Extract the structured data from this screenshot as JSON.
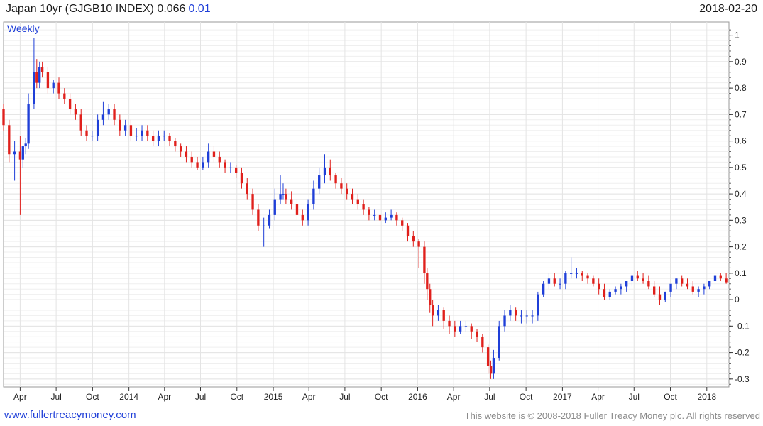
{
  "header": {
    "title": "Japan 10yr (GJGB10 INDEX) 0.066",
    "change": "0.01",
    "date": "2018-02-20"
  },
  "footer": {
    "website": "www.fullertreacymoney.com",
    "copyright": "This website is © 2008-2018 Fuller Treacy Money plc. All rights reserved"
  },
  "colors": {
    "up": "#1f3fd8",
    "down": "#e0201c",
    "grid": "#e4e4e4",
    "axis": "#333333"
  },
  "chart_data": {
    "type": "candlestick",
    "period_label": "Weekly",
    "ylim": [
      -0.33,
      1.05
    ],
    "y_ticks": [
      1,
      0.9,
      0.8,
      0.7,
      0.6,
      0.5,
      0.4,
      0.3,
      0.2,
      0.1,
      0,
      -0.1,
      -0.2,
      -0.3
    ],
    "y_tick_labels": [
      "1",
      "0.9",
      "0.8",
      "0.7",
      "0.6",
      "0.5",
      "0.4",
      "0.3",
      "0.2",
      "0.1",
      "0",
      "-0.1",
      "-0.2",
      "-0.3"
    ],
    "x_range": [
      "2013-02-18",
      "2018-02-26"
    ],
    "x_ticks": [
      {
        "date": "2013-04-01",
        "label": "Apr"
      },
      {
        "date": "2013-07-01",
        "label": "Jul"
      },
      {
        "date": "2013-10-01",
        "label": "Oct"
      },
      {
        "date": "2014-01-01",
        "label": "2014"
      },
      {
        "date": "2014-04-01",
        "label": "Apr"
      },
      {
        "date": "2014-07-01",
        "label": "Jul"
      },
      {
        "date": "2014-10-01",
        "label": "Oct"
      },
      {
        "date": "2015-01-01",
        "label": "2015"
      },
      {
        "date": "2015-04-01",
        "label": "Apr"
      },
      {
        "date": "2015-07-01",
        "label": "Jul"
      },
      {
        "date": "2015-10-01",
        "label": "Oct"
      },
      {
        "date": "2016-01-01",
        "label": "2016"
      },
      {
        "date": "2016-04-01",
        "label": "Apr"
      },
      {
        "date": "2016-07-01",
        "label": "Jul"
      },
      {
        "date": "2016-10-01",
        "label": "Oct"
      },
      {
        "date": "2017-01-01",
        "label": "2017"
      },
      {
        "date": "2017-04-01",
        "label": "Apr"
      },
      {
        "date": "2017-07-01",
        "label": "Jul"
      },
      {
        "date": "2017-10-01",
        "label": "Oct"
      },
      {
        "date": "2018-01-01",
        "label": "2018"
      }
    ],
    "series": [
      {
        "name": "GJGB10 INDEX",
        "x": [
          "2013-02-18",
          "2013-03-04",
          "2013-03-18",
          "2013-04-01",
          "2013-04-08",
          "2013-04-15",
          "2013-04-22",
          "2013-05-06",
          "2013-05-13",
          "2013-05-20",
          "2013-05-27",
          "2013-06-10",
          "2013-06-24",
          "2013-07-08",
          "2013-07-22",
          "2013-08-05",
          "2013-08-19",
          "2013-09-02",
          "2013-09-16",
          "2013-09-30",
          "2013-10-14",
          "2013-10-28",
          "2013-11-11",
          "2013-11-25",
          "2013-12-09",
          "2013-12-23",
          "2014-01-06",
          "2014-01-20",
          "2014-02-03",
          "2014-02-17",
          "2014-03-03",
          "2014-03-17",
          "2014-03-31",
          "2014-04-14",
          "2014-04-28",
          "2014-05-12",
          "2014-05-26",
          "2014-06-09",
          "2014-06-23",
          "2014-07-07",
          "2014-07-21",
          "2014-08-04",
          "2014-08-18",
          "2014-09-01",
          "2014-09-15",
          "2014-09-29",
          "2014-10-13",
          "2014-10-27",
          "2014-11-10",
          "2014-11-24",
          "2014-12-08",
          "2014-12-22",
          "2015-01-05",
          "2015-01-19",
          "2015-01-26",
          "2015-02-02",
          "2015-02-16",
          "2015-03-02",
          "2015-03-16",
          "2015-03-30",
          "2015-04-13",
          "2015-04-27",
          "2015-05-11",
          "2015-05-25",
          "2015-06-08",
          "2015-06-22",
          "2015-07-06",
          "2015-07-20",
          "2015-08-03",
          "2015-08-17",
          "2015-08-31",
          "2015-09-14",
          "2015-09-28",
          "2015-10-12",
          "2015-10-26",
          "2015-11-09",
          "2015-11-23",
          "2015-12-07",
          "2015-12-21",
          "2016-01-04",
          "2016-01-18",
          "2016-01-25",
          "2016-02-01",
          "2016-02-08",
          "2016-02-22",
          "2016-03-07",
          "2016-03-21",
          "2016-04-04",
          "2016-04-18",
          "2016-05-02",
          "2016-05-16",
          "2016-05-30",
          "2016-06-13",
          "2016-06-27",
          "2016-07-04",
          "2016-07-11",
          "2016-07-25",
          "2016-08-08",
          "2016-08-22",
          "2016-09-05",
          "2016-09-19",
          "2016-10-03",
          "2016-10-17",
          "2016-10-31",
          "2016-11-14",
          "2016-11-28",
          "2016-12-12",
          "2016-12-26",
          "2017-01-09",
          "2017-01-23",
          "2017-02-06",
          "2017-02-20",
          "2017-03-06",
          "2017-03-20",
          "2017-04-03",
          "2017-04-17",
          "2017-05-01",
          "2017-05-15",
          "2017-05-29",
          "2017-06-12",
          "2017-06-26",
          "2017-07-10",
          "2017-07-24",
          "2017-08-07",
          "2017-08-21",
          "2017-09-04",
          "2017-09-18",
          "2017-10-02",
          "2017-10-16",
          "2017-10-30",
          "2017-11-13",
          "2017-11-27",
          "2017-12-11",
          "2017-12-25",
          "2018-01-08",
          "2018-01-22",
          "2018-02-05",
          "2018-02-19"
        ],
        "open": [
          0.72,
          0.66,
          0.55,
          0.56,
          0.53,
          0.58,
          0.59,
          0.74,
          0.86,
          0.82,
          0.88,
          0.86,
          0.8,
          0.82,
          0.78,
          0.76,
          0.72,
          0.7,
          0.64,
          0.62,
          0.62,
          0.68,
          0.7,
          0.72,
          0.68,
          0.64,
          0.66,
          0.62,
          0.62,
          0.64,
          0.62,
          0.6,
          0.62,
          0.62,
          0.6,
          0.58,
          0.56,
          0.54,
          0.52,
          0.5,
          0.52,
          0.56,
          0.54,
          0.52,
          0.5,
          0.5,
          0.48,
          0.44,
          0.4,
          0.34,
          0.28,
          0.28,
          0.32,
          0.38,
          0.4,
          0.4,
          0.38,
          0.36,
          0.32,
          0.3,
          0.36,
          0.42,
          0.47,
          0.5,
          0.47,
          0.44,
          0.42,
          0.4,
          0.38,
          0.36,
          0.34,
          0.32,
          0.32,
          0.3,
          0.31,
          0.32,
          0.3,
          0.28,
          0.24,
          0.22,
          0.2,
          0.1,
          0.04,
          -0.02,
          -0.06,
          -0.04,
          -0.08,
          -0.1,
          -0.12,
          -0.1,
          -0.1,
          -0.12,
          -0.14,
          -0.18,
          -0.25,
          -0.28,
          -0.22,
          -0.1,
          -0.06,
          -0.04,
          -0.06,
          -0.06,
          -0.06,
          -0.06,
          0.02,
          0.06,
          0.08,
          0.06,
          0.06,
          0.1,
          0.1,
          0.1,
          0.09,
          0.08,
          0.06,
          0.04,
          0.01,
          0.03,
          0.04,
          0.05,
          0.07,
          0.09,
          0.08,
          0.07,
          0.05,
          0.02,
          0.0,
          0.03,
          0.06,
          0.08,
          0.06,
          0.05,
          0.03,
          0.04,
          0.05,
          0.07,
          0.09,
          0.08
        ],
        "close": [
          0.66,
          0.55,
          0.56,
          0.53,
          0.58,
          0.59,
          0.74,
          0.86,
          0.82,
          0.88,
          0.86,
          0.8,
          0.82,
          0.78,
          0.76,
          0.72,
          0.7,
          0.64,
          0.62,
          0.62,
          0.68,
          0.7,
          0.72,
          0.68,
          0.64,
          0.66,
          0.62,
          0.62,
          0.64,
          0.62,
          0.6,
          0.62,
          0.62,
          0.6,
          0.58,
          0.56,
          0.54,
          0.52,
          0.5,
          0.52,
          0.56,
          0.54,
          0.52,
          0.5,
          0.5,
          0.48,
          0.44,
          0.4,
          0.34,
          0.28,
          0.28,
          0.32,
          0.38,
          0.4,
          0.4,
          0.38,
          0.36,
          0.32,
          0.3,
          0.36,
          0.42,
          0.47,
          0.5,
          0.47,
          0.44,
          0.42,
          0.4,
          0.38,
          0.36,
          0.34,
          0.32,
          0.32,
          0.3,
          0.31,
          0.32,
          0.3,
          0.28,
          0.24,
          0.22,
          0.2,
          0.1,
          0.04,
          -0.02,
          -0.06,
          -0.04,
          -0.08,
          -0.1,
          -0.12,
          -0.1,
          -0.1,
          -0.12,
          -0.14,
          -0.18,
          -0.25,
          -0.28,
          -0.22,
          -0.1,
          -0.06,
          -0.04,
          -0.06,
          -0.06,
          -0.06,
          -0.06,
          0.02,
          0.06,
          0.08,
          0.06,
          0.06,
          0.1,
          0.1,
          0.1,
          0.09,
          0.08,
          0.06,
          0.04,
          0.01,
          0.03,
          0.04,
          0.05,
          0.07,
          0.09,
          0.08,
          0.07,
          0.05,
          0.02,
          0.0,
          0.03,
          0.06,
          0.08,
          0.06,
          0.05,
          0.03,
          0.04,
          0.05,
          0.07,
          0.09,
          0.08,
          0.066
        ],
        "high": [
          0.74,
          0.68,
          0.6,
          0.62,
          0.56,
          0.61,
          0.78,
          0.99,
          0.91,
          0.9,
          0.9,
          0.88,
          0.83,
          0.84,
          0.8,
          0.78,
          0.74,
          0.72,
          0.66,
          0.64,
          0.7,
          0.75,
          0.74,
          0.74,
          0.7,
          0.68,
          0.68,
          0.65,
          0.66,
          0.66,
          0.64,
          0.64,
          0.64,
          0.63,
          0.61,
          0.59,
          0.58,
          0.56,
          0.54,
          0.54,
          0.59,
          0.58,
          0.56,
          0.53,
          0.52,
          0.51,
          0.5,
          0.46,
          0.42,
          0.36,
          0.31,
          0.34,
          0.42,
          0.47,
          0.44,
          0.42,
          0.41,
          0.38,
          0.34,
          0.38,
          0.45,
          0.5,
          0.55,
          0.53,
          0.48,
          0.46,
          0.44,
          0.42,
          0.4,
          0.38,
          0.35,
          0.34,
          0.33,
          0.33,
          0.34,
          0.33,
          0.31,
          0.29,
          0.26,
          0.23,
          0.22,
          0.12,
          0.06,
          0.0,
          -0.02,
          -0.03,
          -0.06,
          -0.08,
          -0.08,
          -0.08,
          -0.09,
          -0.11,
          -0.13,
          -0.17,
          -0.23,
          -0.19,
          -0.08,
          -0.04,
          -0.02,
          -0.03,
          -0.04,
          -0.04,
          -0.04,
          0.03,
          0.07,
          0.1,
          0.1,
          0.08,
          0.11,
          0.16,
          0.12,
          0.11,
          0.1,
          0.09,
          0.08,
          0.06,
          0.04,
          0.05,
          0.06,
          0.07,
          0.09,
          0.11,
          0.1,
          0.09,
          0.07,
          0.05,
          0.03,
          0.05,
          0.08,
          0.09,
          0.08,
          0.07,
          0.05,
          0.06,
          0.07,
          0.09,
          0.1,
          0.1
        ],
        "low": [
          0.64,
          0.52,
          0.45,
          0.32,
          0.5,
          0.55,
          0.57,
          0.72,
          0.8,
          0.8,
          0.84,
          0.78,
          0.78,
          0.76,
          0.74,
          0.7,
          0.68,
          0.62,
          0.6,
          0.6,
          0.6,
          0.66,
          0.68,
          0.66,
          0.62,
          0.62,
          0.6,
          0.6,
          0.6,
          0.6,
          0.58,
          0.58,
          0.6,
          0.58,
          0.56,
          0.54,
          0.52,
          0.5,
          0.49,
          0.49,
          0.5,
          0.52,
          0.5,
          0.48,
          0.48,
          0.46,
          0.42,
          0.38,
          0.32,
          0.26,
          0.2,
          0.27,
          0.3,
          0.36,
          0.38,
          0.36,
          0.34,
          0.3,
          0.28,
          0.28,
          0.34,
          0.4,
          0.44,
          0.45,
          0.42,
          0.4,
          0.38,
          0.36,
          0.34,
          0.32,
          0.3,
          0.3,
          0.29,
          0.29,
          0.3,
          0.28,
          0.26,
          0.22,
          0.2,
          0.12,
          0.06,
          0.0,
          -0.05,
          -0.1,
          -0.08,
          -0.11,
          -0.13,
          -0.14,
          -0.13,
          -0.12,
          -0.15,
          -0.16,
          -0.2,
          -0.28,
          -0.3,
          -0.3,
          -0.23,
          -0.12,
          -0.08,
          -0.08,
          -0.09,
          -0.09,
          -0.09,
          -0.08,
          0.01,
          0.04,
          0.05,
          0.04,
          0.04,
          0.08,
          0.08,
          0.07,
          0.06,
          0.05,
          0.02,
          0.0,
          0.0,
          0.02,
          0.02,
          0.03,
          0.05,
          0.07,
          0.06,
          0.04,
          0.01,
          -0.02,
          -0.01,
          0.01,
          0.04,
          0.05,
          0.04,
          0.02,
          0.01,
          0.02,
          0.04,
          0.05,
          0.07,
          0.06
        ]
      }
    ]
  }
}
